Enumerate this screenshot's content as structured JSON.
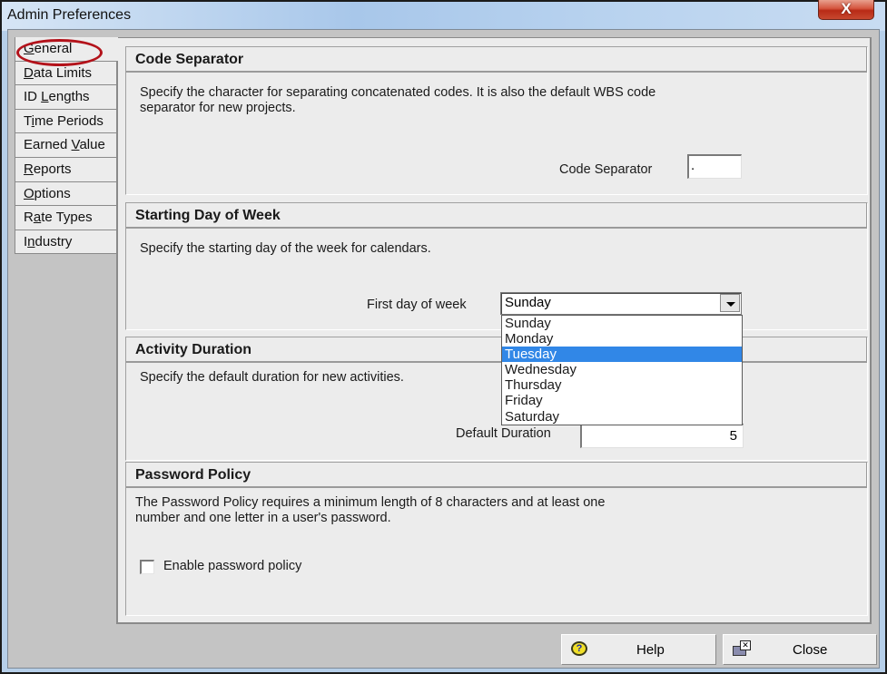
{
  "window": {
    "title": "Admin Preferences",
    "close_glyph": "X"
  },
  "tabs": [
    {
      "pre": "",
      "key": "G",
      "post": "eneral",
      "label": "General",
      "active": true
    },
    {
      "pre": "",
      "key": "D",
      "post": "ata Limits",
      "label": "Data Limits",
      "active": false
    },
    {
      "pre": "ID ",
      "key": "L",
      "post": "engths",
      "label": "ID Lengths",
      "active": false
    },
    {
      "pre": "T",
      "key": "i",
      "post": "me Periods",
      "label": "Time Periods",
      "active": false
    },
    {
      "pre": "Earned ",
      "key": "V",
      "post": "alue",
      "label": "Earned Value",
      "active": false
    },
    {
      "pre": "",
      "key": "R",
      "post": "eports",
      "label": "Reports",
      "active": false
    },
    {
      "pre": "",
      "key": "O",
      "post": "ptions",
      "label": "Options",
      "active": false
    },
    {
      "pre": "R",
      "key": "a",
      "post": "te Types",
      "label": "Rate Types",
      "active": false
    },
    {
      "pre": "I",
      "key": "n",
      "post": "dustry",
      "label": "Industry",
      "active": false
    }
  ],
  "code_separator": {
    "header": "Code Separator",
    "description_line1": "Specify the character for separating concatenated codes.  It is also the default WBS code",
    "description_line2": "separator for new projects.",
    "field_label": "Code Separator",
    "value": "."
  },
  "starting_day": {
    "header": "Starting Day of Week",
    "description": "Specify the starting day of the week for calendars.",
    "field_label": "First day of week",
    "selected": "Sunday",
    "options": [
      "Sunday",
      "Monday",
      "Tuesday",
      "Wednesday",
      "Thursday",
      "Friday",
      "Saturday"
    ],
    "highlighted": "Tuesday",
    "highlight_color": "#3187e7"
  },
  "activity_duration": {
    "header": "Activity Duration",
    "description": "Specify the default duration for new activities.",
    "field_label": "Default Duration",
    "value": "5"
  },
  "password_policy": {
    "header": "Password Policy",
    "description_line1": "The Password Policy requires a minimum length of 8 characters and at least one",
    "description_line2": "number and one letter in a user's password.",
    "checkbox_label": "Enable password policy",
    "checked": false
  },
  "buttons": {
    "help": "Help",
    "close": "Close",
    "help_icon_glyph": "?",
    "close_icon_glyph": "✕"
  },
  "annotation": {
    "ring_color": "#b3121a",
    "target": "General"
  }
}
